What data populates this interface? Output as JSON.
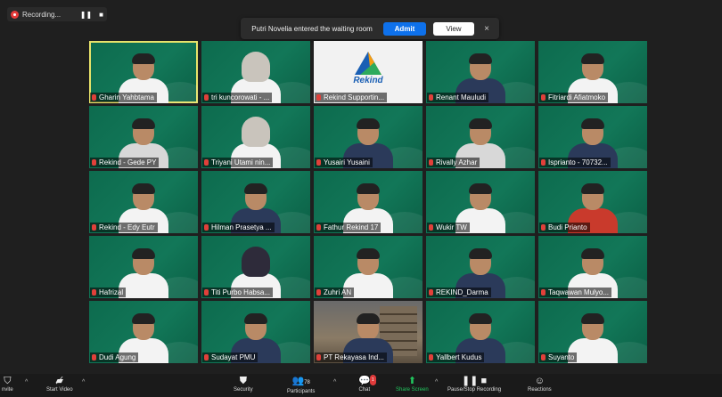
{
  "recording": {
    "label": "Recording...",
    "pause": "❚❚",
    "stop": "■"
  },
  "notification": {
    "message": "Putri Novelia entered the waiting room",
    "admit": "Admit",
    "view": "View",
    "close": "×"
  },
  "participants": [
    {
      "name": "Gharin Yahbtama",
      "style": "",
      "active": true
    },
    {
      "name": "tri kuncorowati - ...",
      "style": "hijab"
    },
    {
      "name": "Rekind Supportin...",
      "style": "logo"
    },
    {
      "name": "Renant Mauludi",
      "style": "dark"
    },
    {
      "name": "Fitriardi Afiatmoko",
      "style": ""
    },
    {
      "name": "Rekind - Gede PY",
      "style": "grey"
    },
    {
      "name": "Triyani Utami nin...",
      "style": "hijab"
    },
    {
      "name": "Yusairi Yusaini",
      "style": "dark"
    },
    {
      "name": "Rivally Azhar",
      "style": "grey"
    },
    {
      "name": "Isprianto - 70732...",
      "style": "dark"
    },
    {
      "name": "Rekind - Edy Eutr",
      "style": ""
    },
    {
      "name": "Hilman Prasetya ...",
      "style": "dark"
    },
    {
      "name": "Fathur Rekind 17",
      "style": ""
    },
    {
      "name": "Wukir TW",
      "style": ""
    },
    {
      "name": "Budi Prianto",
      "style": "red"
    },
    {
      "name": "Hafrizal",
      "style": ""
    },
    {
      "name": "Titi Purbo Habsa...",
      "style": "hijab2"
    },
    {
      "name": "Zuhri AN",
      "style": ""
    },
    {
      "name": "REKIND_Darma",
      "style": "dark"
    },
    {
      "name": "Taqwawan Mulyo...",
      "style": ""
    },
    {
      "name": "Dudi Agung",
      "style": ""
    },
    {
      "name": "Sudayat PMU",
      "style": "dark"
    },
    {
      "name": "PT Rekayasa Ind...",
      "style": "photo"
    },
    {
      "name": "Yallbert Kudus",
      "style": "dark"
    },
    {
      "name": "Suyanto",
      "style": ""
    }
  ],
  "rekind_logo_text": "Rekind",
  "toolbar": {
    "invite": "nvite",
    "start_video": "Start Video",
    "security": "Security",
    "participants": "Participants",
    "participant_count": "78",
    "chat": "Chat",
    "chat_badge": "1",
    "share_screen": "Share Screen",
    "recording": "Pause/Stop Recording",
    "reactions": "Reactions"
  },
  "colors": {
    "tile_green": "#127758",
    "admit_blue": "#0e71eb",
    "active_outline": "#e8e36a",
    "share_green": "#22c55e"
  }
}
